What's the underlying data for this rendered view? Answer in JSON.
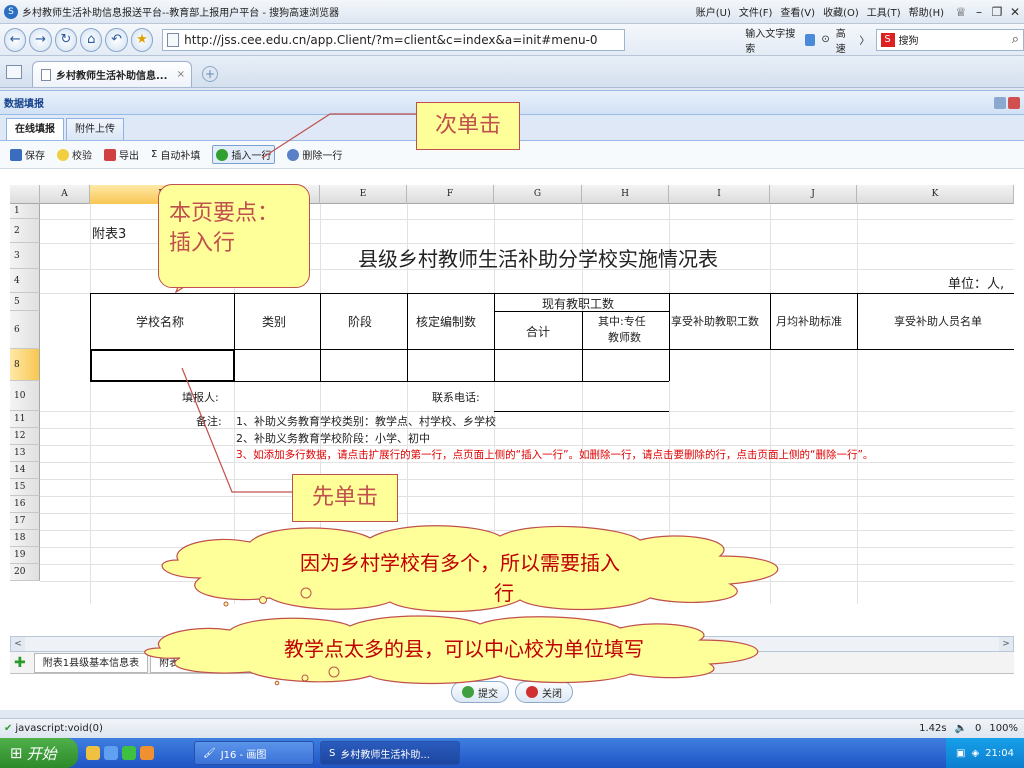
{
  "browser": {
    "window_title": "乡村教师生活补助信息报送平台--教育部上报用户平台 - 搜狗高速浏览器",
    "menus": [
      "账户(U)",
      "文件(F)",
      "查看(V)",
      "收藏(O)",
      "工具(T)",
      "帮助(H)"
    ],
    "url": "http://jss.cee.edu.cn/app.Client/?m=client&c=index&a=init#menu-0",
    "input_hint": "输入文字搜索",
    "speed_label": "高速",
    "search_placeholder": "搜狗",
    "tab_title": "乡村教师生活补助信息...",
    "tab_close": "×"
  },
  "panel": {
    "title": "数据填报",
    "subtabs": [
      "在线填报",
      "附件上传"
    ],
    "toolbar": {
      "save": "保存",
      "verify": "校验",
      "export": "导出",
      "autofill": "自动补填",
      "insert_row": "插入一行",
      "delete_row": "删除一行"
    }
  },
  "sheet": {
    "columns": [
      "A",
      "B",
      "C",
      "E",
      "F",
      "G",
      "H",
      "I",
      "J",
      "K"
    ],
    "rows": [
      "1",
      "2",
      "3",
      "4",
      "5",
      "6",
      "8",
      "10",
      "11",
      "12",
      "13",
      "14",
      "15",
      "16",
      "17",
      "18",
      "19",
      "20"
    ],
    "appendix_label": "附表3",
    "table_title": "县级乡村教师生活补助分学校实施情况表",
    "unit_label": "单位：人,",
    "headers": {
      "school_name": "学校名称",
      "category": "类别",
      "stage": "阶段",
      "approved_staff": "核定编制数",
      "current_staff": "现有教职工数",
      "total": "合计",
      "fulltime_teachers_line1": "其中:专任",
      "fulltime_teachers_line2": "教师数",
      "subsidized_staff": "享受补助教职工数",
      "monthly_standard": "月均补助标准",
      "subsidized_list": "享受补助人员名单"
    },
    "filler_label": "填报人:",
    "phone_label": "联系电话:",
    "remark_label": "备注:",
    "notes": [
      "1、补助义务教育学校类别：教学点、村学校、乡学校",
      "2、补助义务教育学校阶段：小学、初中",
      "3、如添加多行数据，请点击扩展行的第一行，点页面上侧的“插入一行”。如删除一行，请点击要删除的行，点击页面上侧的“删除一行”。"
    ],
    "sheet_tabs": [
      "附表1县级基本信息表",
      "附表2县级实施情况表"
    ],
    "scroll_left": "<",
    "scroll_right": ">"
  },
  "buttons": {
    "submit": "提交",
    "close": "关闭"
  },
  "status": {
    "left": "javascript:void(0)",
    "load_time": "1.42s",
    "count": "0",
    "zoom": "100%"
  },
  "taskbar": {
    "start": "开始",
    "items": [
      "J16 - 画图",
      "乡村教师生活补助..."
    ],
    "clock": "21:04"
  },
  "annotations": {
    "second_click": "次单击",
    "page_point": "本页要点：插入行",
    "first_click": "先单击",
    "cloud1_line1": "因为乡村学校有多个，所以需要插入",
    "cloud1_line2": "行",
    "cloud2": "教学点太多的县，可以中心校为单位填写"
  },
  "colors": {
    "callout_fill": "#ffff99",
    "callout_text": "#c0504d",
    "note_red": "#e00000",
    "cloud_fill": "#ffff99"
  }
}
